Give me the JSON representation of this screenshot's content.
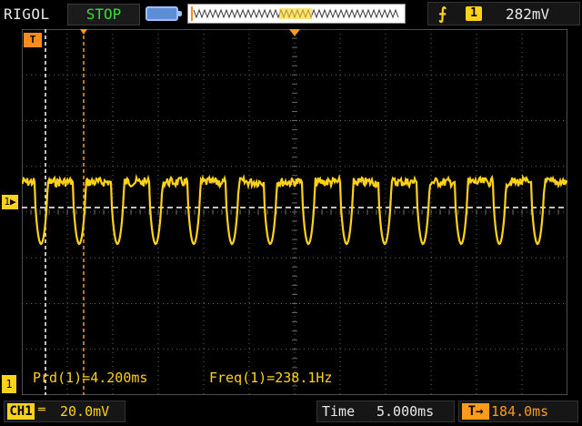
{
  "header": {
    "brand": "RIGOL",
    "run_state": "STOP",
    "trigger": {
      "edge_symbol": "⨍",
      "source": "1",
      "level": "282mV"
    }
  },
  "markers": {
    "trigger_position": "T",
    "ch1_offset": "1▶",
    "ch1_bottom": "1"
  },
  "measurements": {
    "period": "Prd(1)=4.200ms",
    "frequency": "Freq(1)=238.1Hz"
  },
  "footer": {
    "channel_label": "CH1",
    "coupling_symbol": "═",
    "vertical_scale": "20.0mV",
    "time_label": "Time",
    "time_scale": "5.000ms",
    "delay_icon": "T→",
    "delay_value": "184.0ms"
  },
  "colors": {
    "ch1": "#ffd21a",
    "trigger": "#ff9a1a",
    "run_state": "#33e033",
    "grid": "#666666"
  },
  "icons": {
    "battery": "battery-icon",
    "trigger_edge": "rising-edge-icon"
  },
  "waveform": {
    "period_divisions": 0.84,
    "pulse_count": 14
  }
}
